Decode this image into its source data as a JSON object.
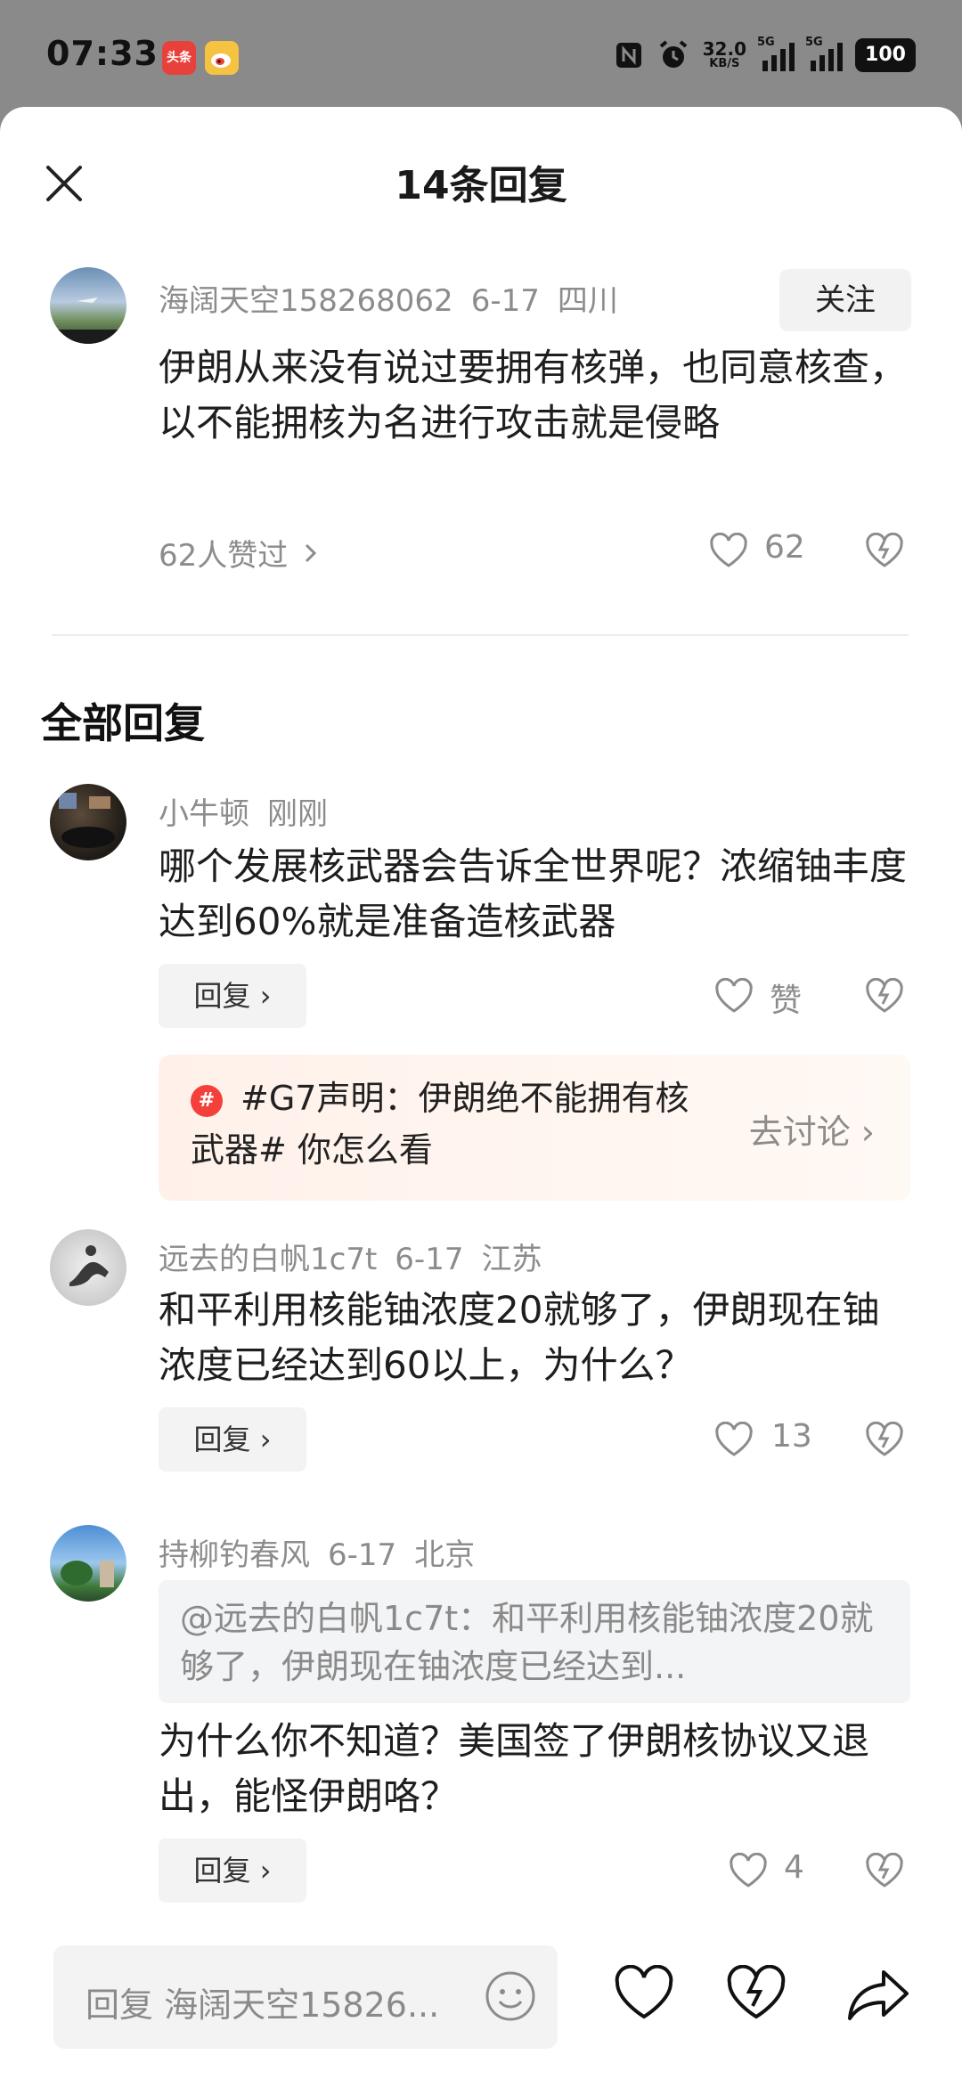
{
  "status_bar": {
    "time": "07:33",
    "app_icons": [
      "头条",
      "weibo-icon"
    ],
    "net_speed": "32.0",
    "net_unit": "KB/S",
    "sig1": "5G",
    "sig2": "5G",
    "battery": "100"
  },
  "header": {
    "title": "14条回复"
  },
  "main_comment": {
    "user": "海阔天空158268062",
    "date": "6-17",
    "location": "四川",
    "follow_label": "关注",
    "text": "伊朗从来没有说过要拥有核弹，也同意核查，以不能拥核为名进行攻击就是侵略",
    "liked_by": "62人赞过",
    "likes": "62"
  },
  "section_title": "全部回复",
  "replies": [
    {
      "user": "小牛顿",
      "date": "刚刚",
      "location": "",
      "text": "哪个发展核武器会告诉全世界呢？浓缩铀丰度达到60%就是准备造核武器",
      "reply_label": "回复",
      "likes": "赞"
    },
    {
      "user": "远去的白帆1c7t",
      "date": "6-17",
      "location": "江苏",
      "text": "和平利用核能铀浓度20就够了，伊朗现在铀浓度已经达到60以上，为什么？",
      "reply_label": "回复",
      "likes": "13"
    },
    {
      "user": "持柳钓春风",
      "date": "6-17",
      "location": "北京",
      "quote": "@远去的白帆1c7t：和平利用核能铀浓度20就够了，伊朗现在铀浓度已经达到...",
      "text": "为什么你不知道？美国签了伊朗核协议又退出，能怪伊朗咯？",
      "reply_label": "回复",
      "likes": "4"
    }
  ],
  "topic": {
    "text": "#G7声明：伊朗绝不能拥有核武器# 你怎么看",
    "action": "去讨论"
  },
  "bottom_bar": {
    "placeholder": "回复 海阔天空15826..."
  }
}
